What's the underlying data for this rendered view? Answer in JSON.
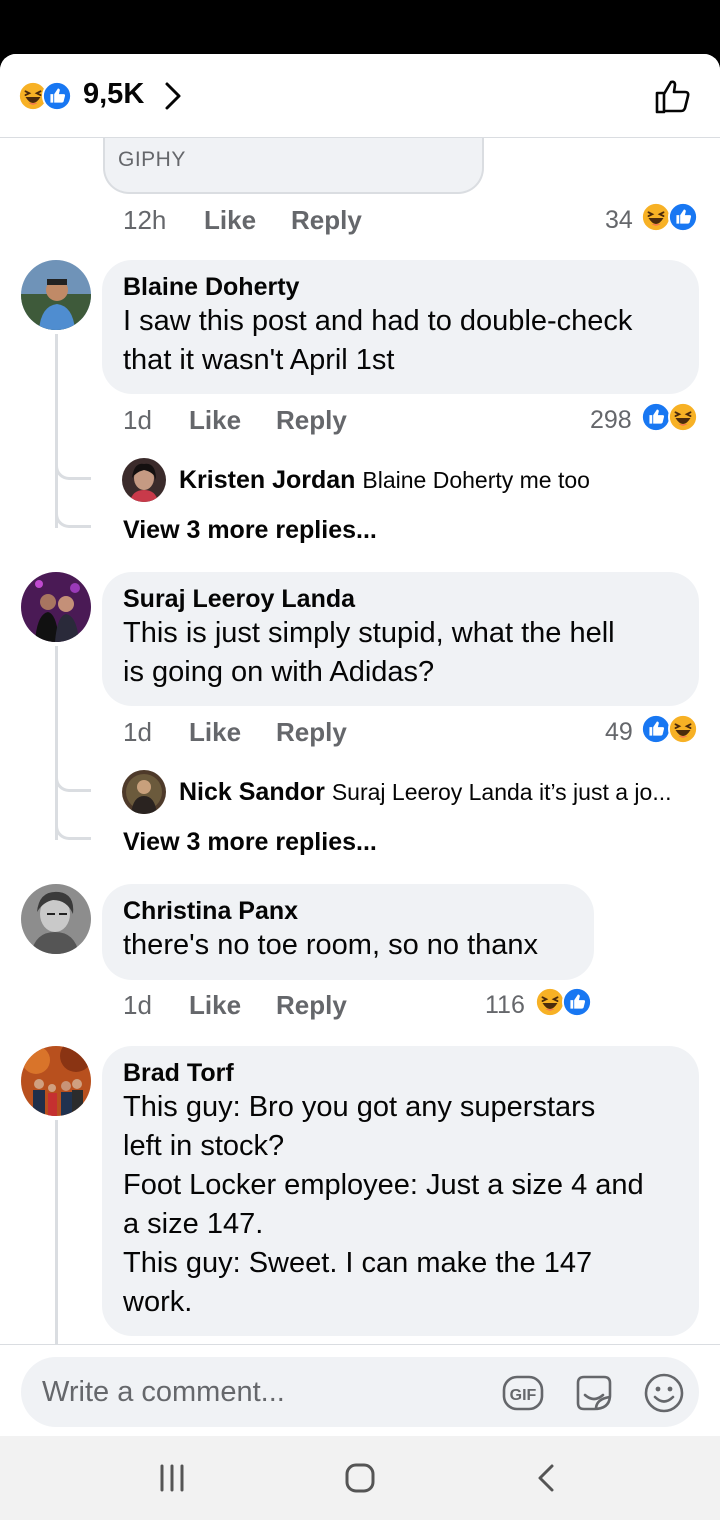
{
  "header": {
    "reaction_count": "9,5K"
  },
  "top_comment": {
    "gif_label": "GIPHY",
    "time": "12h",
    "like_label": "Like",
    "reply_label": "Reply",
    "reaction_count": "34"
  },
  "comments": [
    {
      "name": "Blaine Doherty",
      "text": "I saw this post and had to double-check\nthat it wasn't April 1st",
      "time": "1d",
      "like_label": "Like",
      "reply_label": "Reply",
      "reaction_count": "298",
      "reply": {
        "name": "Kristen Jordan",
        "text": "Blaine Doherty me too"
      },
      "view_more": "View 3 more replies..."
    },
    {
      "name": "Suraj Leeroy Landa",
      "text": "This is just simply stupid, what the hell\nis going on with Adidas?",
      "time": "1d",
      "like_label": "Like",
      "reply_label": "Reply",
      "reaction_count": "49",
      "reply": {
        "name": "Nick Sandor",
        "text": "Suraj Leeroy Landa it’s just a jo..."
      },
      "view_more": "View 3 more replies..."
    },
    {
      "name": "Christina Panx",
      "text": "there's no toe room, so no thanx",
      "time": "1d",
      "like_label": "Like",
      "reply_label": "Reply",
      "reaction_count": "116"
    },
    {
      "name": "Brad Torf",
      "text": "This guy: Bro you got any superstars\nleft in stock?\nFoot Locker employee: Just a size 4 and\na size 147.\nThis guy: Sweet. I can make the 147\nwork."
    }
  ],
  "composer": {
    "placeholder": "Write a comment...",
    "gif_label": "GIF"
  },
  "colors": {
    "like_blue": "#1877f2",
    "haha_yellow": "#f7b125",
    "secondary_text": "#65676b",
    "bubble_bg": "#f0f2f5"
  },
  "icons": [
    "haha-reaction-icon",
    "like-reaction-icon",
    "chevron-right-icon",
    "thumbs-up-outline-icon",
    "gif-icon",
    "sticker-icon",
    "emoji-icon",
    "recent-apps-icon",
    "home-icon",
    "back-icon"
  ]
}
